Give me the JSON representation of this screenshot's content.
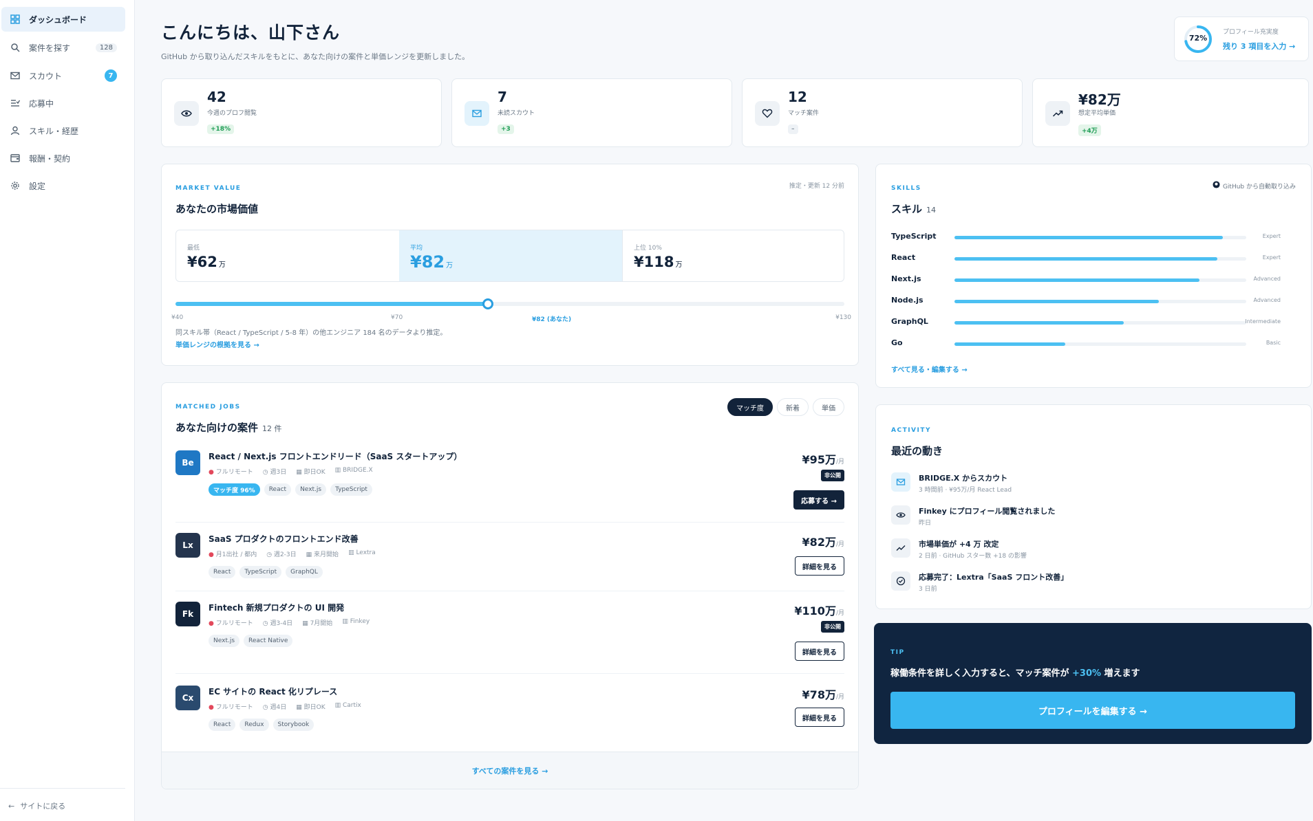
{
  "sidebar": {
    "items": [
      {
        "label": "ダッシュボード",
        "icon": "grid-icon",
        "active": true
      },
      {
        "label": "案件を探す",
        "icon": "search-icon",
        "count": "128"
      },
      {
        "label": "スカウト",
        "icon": "mail-icon",
        "badge": "7"
      },
      {
        "label": "応募中",
        "icon": "list-check-icon"
      },
      {
        "label": "スキル・経歴",
        "icon": "user-icon"
      },
      {
        "label": "報酬・契約",
        "icon": "wallet-icon"
      },
      {
        "label": "設定",
        "icon": "gear-icon"
      }
    ],
    "back_label": "サイトに戻る"
  },
  "header": {
    "greeting": "こんにちは、山下さん",
    "subtext": "GitHub から取り込んだスキルをもとに、あなた向けの案件と単価レンジを更新しました。"
  },
  "profile": {
    "percent_label": "72%",
    "completion": 0.72,
    "label": "プロフィール充実度",
    "link": "残り 3 項目を入力 →"
  },
  "stats": [
    {
      "value": "42",
      "label": "今週のプロフ閲覧",
      "delta": "+18%",
      "icon": "eye-icon"
    },
    {
      "value": "7",
      "label": "未読スカウト",
      "delta": "+3",
      "icon": "mail-icon"
    },
    {
      "value": "12",
      "label": "マッチ案件",
      "delta": "–",
      "icon": "heart-icon"
    },
    {
      "value": "¥82万",
      "label": "想定平均単価",
      "delta": "+4万",
      "icon": "trend-icon"
    }
  ],
  "market": {
    "kicker": "MARKET VALUE",
    "title": "あなたの市場価値",
    "note": "推定・更新 12 分前",
    "cells": [
      {
        "label": "最低",
        "value": "¥62",
        "unit": "万"
      },
      {
        "label": "平均",
        "value": "¥82",
        "unit": "万"
      },
      {
        "label": "上位 10%",
        "value": "¥118",
        "unit": "万"
      }
    ],
    "range_min": 40,
    "range_max": 130,
    "you": 82,
    "ticks": [
      "¥40",
      "¥70",
      "¥82 (あなた)",
      "¥130"
    ],
    "source": "同スキル帯（React / TypeScript / 5-8 年）の他エンジニア 184 名のデータより推定。",
    "link": "単価レンジの根拠を見る →"
  },
  "jobs": {
    "kicker": "MATCHED JOBS",
    "title": "あなた向けの案件",
    "count": "12 件",
    "sort": [
      "マッチ度",
      "新着",
      "単価"
    ],
    "items": [
      {
        "logo": "Be",
        "color": "#1f78c4",
        "title": "React / Next.js フロントエンドリード（SaaS スタートアップ）",
        "meta": [
          "フルリモート",
          "週3日",
          "即日OK",
          "BRIDGE.X"
        ],
        "tags": [
          "マッチ度 96%",
          "React",
          "Next.js",
          "TypeScript"
        ],
        "price": "¥95万",
        "unit": "/月",
        "private": "非公開",
        "button": "応募する →"
      },
      {
        "logo": "Lx",
        "color": "#24344d",
        "title": "SaaS プロダクトのフロントエンド改善",
        "meta": [
          "月1出社 / 都内",
          "週2-3日",
          "来月開始",
          "Lextra"
        ],
        "tags": [
          "React",
          "TypeScript",
          "GraphQL"
        ],
        "price": "¥82万",
        "unit": "/月",
        "button": "詳細を見る"
      },
      {
        "logo": "Fk",
        "color": "#12233a",
        "title": "Fintech 新規プロダクトの UI 開発",
        "meta": [
          "フルリモート",
          "週3-4日",
          "7月開始",
          "Finkey"
        ],
        "tags": [
          "Next.js",
          "React Native"
        ],
        "price": "¥110万",
        "unit": "/月",
        "private": "非公開",
        "button": "詳細を見る"
      },
      {
        "logo": "Cx",
        "color": "#2a4a6e",
        "title": "EC サイトの React 化リプレース",
        "meta": [
          "フルリモート",
          "週4日",
          "即日OK",
          "Cartix"
        ],
        "tags": [
          "React",
          "Redux",
          "Storybook"
        ],
        "price": "¥78万",
        "unit": "/月",
        "button": "詳細を見る"
      }
    ],
    "footer": "すべての案件を見る →"
  },
  "skills": {
    "kicker": "SKILLS",
    "title": "スキル",
    "count": "14",
    "source": "GitHub から自動取り込み",
    "items": [
      {
        "name": "TypeScript",
        "level": "Expert",
        "value": 0.92
      },
      {
        "name": "React",
        "level": "Expert",
        "value": 0.9
      },
      {
        "name": "Next.js",
        "level": "Advanced",
        "value": 0.84
      },
      {
        "name": "Node.js",
        "level": "Advanced",
        "value": 0.7
      },
      {
        "name": "GraphQL",
        "level": "Intermediate",
        "value": 0.58
      },
      {
        "name": "Go",
        "level": "Basic",
        "value": 0.38
      }
    ],
    "link": "すべて見る・編集する →"
  },
  "activity": {
    "kicker": "ACTIVITY",
    "title": "最近の動き",
    "items": [
      {
        "icon": "mail-icon",
        "title": "BRIDGE.X からスカウト",
        "sub": "3 時間前 · ¥95万/月 React Lead"
      },
      {
        "icon": "eye-icon",
        "title": "Finkey にプロフィール閲覧されました",
        "sub": "昨日"
      },
      {
        "icon": "trend-icon",
        "title": "市場単価が +4 万 改定",
        "sub": "2 日前 · GitHub スター数 +18 の影響"
      },
      {
        "icon": "check-circle-icon",
        "title": "応募完了：Lextra「SaaS フロント改善」",
        "sub": "3 日前"
      }
    ]
  },
  "tip": {
    "kicker": "TIP",
    "text_before": "稼働条件を詳しく入力すると、マッチ案件が ",
    "text_highlight": "+30%",
    "text_after": " 増えます",
    "button": "プロフィールを編集する →"
  }
}
